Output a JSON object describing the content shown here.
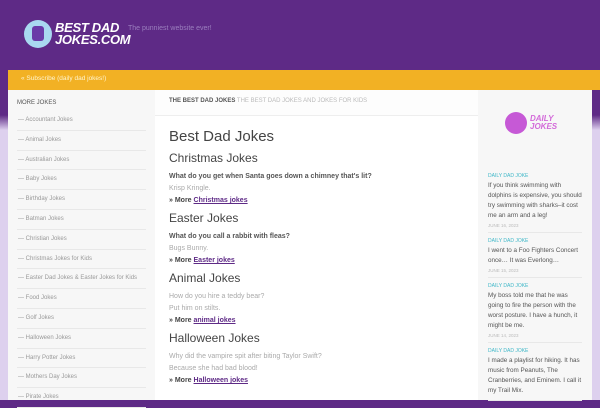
{
  "header": {
    "logo_text": "BEST DAD JOKES.COM",
    "tagline": "The punniest website ever!"
  },
  "subscribe": "« Subscribe (daily dad jokes!)",
  "sidebar": {
    "title": "MORE JOKES",
    "items": [
      "Accountant Jokes",
      "Animal Jokes",
      "Australian Jokes",
      "Baby Jokes",
      "Birthday Jokes",
      "Batman Jokes",
      "Christian Jokes",
      "Christmas Jokes for Kids",
      "Easter Dad Jokes & Easter Jokes for Kids",
      "Food Jokes",
      "Golf Jokes",
      "Halloween Jokes",
      "Harry Potter Jokes",
      "Mothers Day Jokes",
      "Pirate Jokes"
    ]
  },
  "breadcrumb": {
    "home": "THE BEST DAD JOKES",
    "current": "THE BEST DAD JOKES AND JOKES FOR KIDS"
  },
  "main": {
    "title": "Best Dad Jokes",
    "sections": [
      {
        "heading": "Christmas Jokes",
        "q": "What do you get when Santa goes down a chimney that's lit?",
        "a": "Krisp Kringle.",
        "more": "» More",
        "link": "Christmas jokes"
      },
      {
        "heading": "Easter Jokes",
        "q": "What do you call a rabbit with fleas?",
        "a": "Bugs Bunny.",
        "more": "» More",
        "link": "Easter jokes"
      },
      {
        "heading": "Animal Jokes",
        "q": "How do you hire a teddy bear?",
        "a": "Put him on stilts.",
        "more": "» More",
        "link": "animal jokes"
      },
      {
        "heading": "Halloween Jokes",
        "q": "Why did the vampire spit after biting Taylor Swift?",
        "a": "Because she had bad blood!",
        "more": "» More",
        "link": "Halloween jokes"
      }
    ]
  },
  "right": {
    "logo_text": "DAILY JOKES",
    "jokes": [
      {
        "label": "DAILY DAD JOKE",
        "text": "If you think swimming with dolphins is expensive, you should try swimming with sharks–it cost me an arm and a leg!",
        "date": "JUNE 16, 2023"
      },
      {
        "label": "DAILY DAD JOKE",
        "text": "I went to a Foo Fighters Concert once… It was Everlong…",
        "date": "JUNE 15, 2023"
      },
      {
        "label": "DAILY DAD JOKE",
        "text": "My boss told me that he was going to fire the person with the worst posture. I have a hunch, it might be me.",
        "date": "JUNE 14, 2023"
      },
      {
        "label": "DAILY DAD JOKE",
        "text": "I made a playlist for hiking. It has music from Peanuts, The Cranberries, and Eminem. I call it my Trail Mix.",
        "date": ""
      }
    ]
  }
}
